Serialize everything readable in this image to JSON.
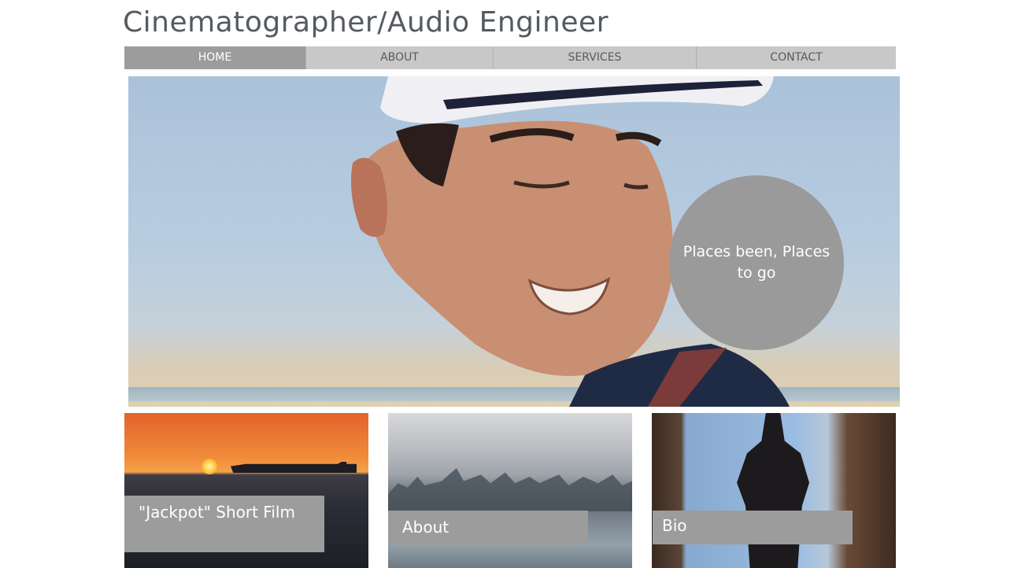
{
  "site": {
    "title": "Cinematographer/Audio Engineer"
  },
  "nav": {
    "items": [
      {
        "label": "HOME",
        "active": true
      },
      {
        "label": "ABOUT",
        "active": false
      },
      {
        "label": "SERVICES",
        "active": false
      },
      {
        "label": "CONTACT",
        "active": false
      }
    ]
  },
  "hero": {
    "circle_text": "Places been, Places to go"
  },
  "cards": [
    {
      "label": "\"Jackpot\" Short Film"
    },
    {
      "label": "About"
    },
    {
      "label": "Bio"
    }
  ],
  "colors": {
    "nav_background": "#c8c8c8",
    "nav_active": "#9c9c9c",
    "label_background": "#9c9c9c",
    "title_text": "#555a60"
  }
}
